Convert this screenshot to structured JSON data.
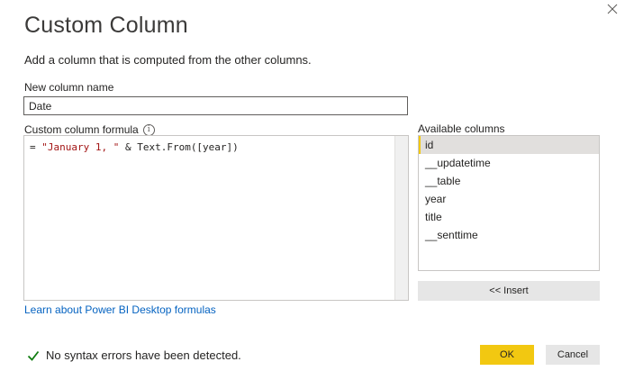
{
  "dialog": {
    "title": "Custom Column",
    "subtitle": "Add a column that is computed from the other columns.",
    "close_icon": "close-icon"
  },
  "new_column": {
    "label": "New column name",
    "value": "Date"
  },
  "formula": {
    "label": "Custom column formula",
    "info_icon": "info-icon",
    "info_glyph": "i",
    "prefix": "= ",
    "string_literal": "\"January 1, \"",
    "rest": " & Text.From([year])"
  },
  "available_columns": {
    "label": "Available columns",
    "items": [
      "id",
      "__updatetime",
      "__table",
      "year",
      "title",
      "__senttime"
    ],
    "selected_index": 0,
    "insert_label": "<< Insert"
  },
  "learn_link": "Learn about Power BI Desktop formulas",
  "status": {
    "icon": "checkmark-icon",
    "text": "No syntax errors have been detected."
  },
  "buttons": {
    "ok": "OK",
    "cancel": "Cancel"
  },
  "colors": {
    "accent": "#f2c811",
    "link": "#0563c1",
    "success": "#107c10",
    "string": "#a31515"
  }
}
